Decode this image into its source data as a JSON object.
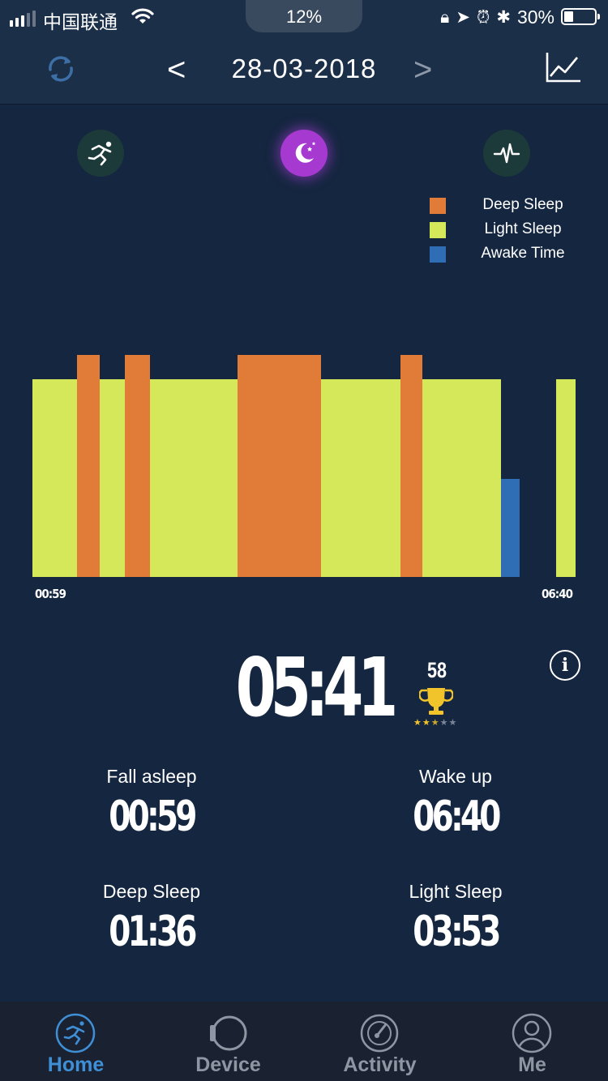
{
  "status_bar": {
    "carrier": "中国联通",
    "center_percent": "12%",
    "battery_percent": "30%",
    "battery_level": 0.3
  },
  "header": {
    "prev_label": "<",
    "date": "28-03-2018",
    "next_label": ">"
  },
  "modes": [
    {
      "icon": "running-icon",
      "active": false
    },
    {
      "icon": "moon-icon",
      "active": true
    },
    {
      "icon": "heartbeat-icon",
      "active": false
    }
  ],
  "colors": {
    "deep": "#e07c38",
    "light": "#d4e85a",
    "awake": "#2f6db5",
    "background": "#152640",
    "active_tab": "#3f8fd6"
  },
  "legend": [
    {
      "label": "Deep Sleep",
      "color": "#e07c38"
    },
    {
      "label": "Light Sleep",
      "color": "#d4e85a"
    },
    {
      "label": "Awake Time",
      "color": "#2f6db5"
    }
  ],
  "chart_data": {
    "type": "bar",
    "x_start": "00:59",
    "x_end": "06:40",
    "segments": [
      {
        "stage": "light",
        "start": "00:59",
        "end": "01:27"
      },
      {
        "stage": "deep",
        "start": "01:27",
        "end": "01:41"
      },
      {
        "stage": "light",
        "start": "01:41",
        "end": "01:57"
      },
      {
        "stage": "deep",
        "start": "01:57",
        "end": "02:13"
      },
      {
        "stage": "light",
        "start": "02:13",
        "end": "03:08"
      },
      {
        "stage": "deep",
        "start": "03:08",
        "end": "04:00"
      },
      {
        "stage": "light",
        "start": "04:00",
        "end": "04:50"
      },
      {
        "stage": "deep",
        "start": "04:50",
        "end": "05:04"
      },
      {
        "stage": "light",
        "start": "05:04",
        "end": "05:53"
      },
      {
        "stage": "awake",
        "start": "05:53",
        "end": "06:05"
      },
      {
        "stage": "light",
        "start": "06:28",
        "end": "06:40"
      }
    ],
    "stage_levels": {
      "deep": 1.0,
      "light": 0.89,
      "awake": 0.44
    },
    "x_ticks": [
      "00:59",
      "06:40"
    ]
  },
  "summary": {
    "total_sleep": "05:41",
    "score": "58",
    "stars_filled": 2.5,
    "stars_total": 5
  },
  "stats": [
    {
      "label": "Fall asleep",
      "value": "00:59"
    },
    {
      "label": "Wake up",
      "value": "06:40"
    },
    {
      "label": "Deep Sleep",
      "value": "01:36"
    },
    {
      "label": "Light Sleep",
      "value": "03:53"
    }
  ],
  "tabs": [
    {
      "label": "Home",
      "icon": "runner-icon",
      "active": true
    },
    {
      "label": "Device",
      "icon": "watch-icon",
      "active": false
    },
    {
      "label": "Activity",
      "icon": "gauge-icon",
      "active": false
    },
    {
      "label": "Me",
      "icon": "profile-icon",
      "active": false
    }
  ]
}
